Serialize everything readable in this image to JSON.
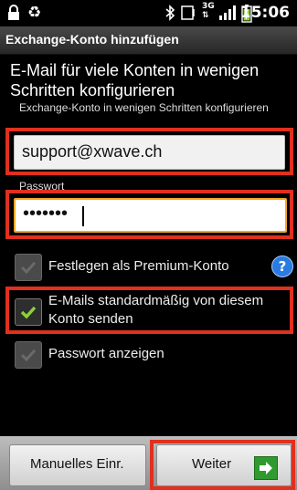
{
  "status_bar": {
    "time": "15:06",
    "icons": [
      "lock-icon",
      "recycle-icon",
      "bluetooth-icon",
      "screen-icon",
      "3g-icon",
      "signal-icon",
      "battery-icon"
    ]
  },
  "title": "Exchange-Konto hinzufügen",
  "heading": "E-Mail für viele Konten in wenigen Schritten konfigurieren",
  "subheading": "Exchange-Konto in wenigen Schritten konfigurieren",
  "email_field": {
    "value": "support@xwave.ch"
  },
  "password": {
    "label": "Passwort",
    "masked_value": "•••••••"
  },
  "options": [
    {
      "label": "Festlegen als Premium-Konto",
      "checked": false
    },
    {
      "label": "E-Mails standardmäßig von diesem Konto senden",
      "checked": true
    },
    {
      "label": "Passwort anzeigen",
      "checked": false
    }
  ],
  "buttons": {
    "manual": "Manuelles Einr.",
    "next": "Weiter"
  },
  "colors": {
    "highlight": "#e0301e",
    "check": "#8bd13a",
    "help": "#2a7be0",
    "next_arrow": "#2f9a2f"
  }
}
